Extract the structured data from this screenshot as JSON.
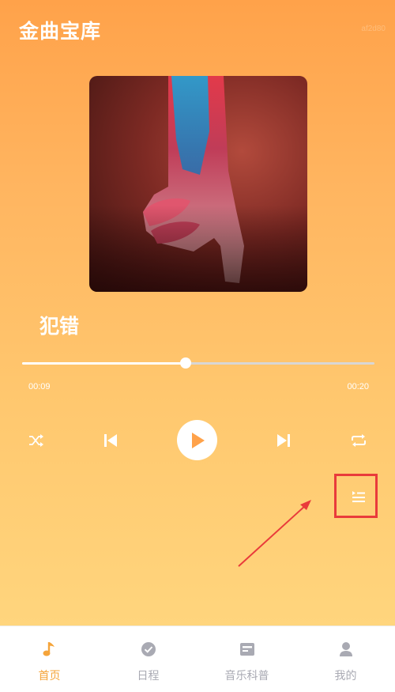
{
  "header": {
    "app_title": "金曲宝库",
    "watermark": "af2d80"
  },
  "player": {
    "song_title": "犯错",
    "current_time": "00:09",
    "total_time": "00:20",
    "progress": 0.465
  },
  "controls": [
    {
      "icon": "shuffle-icon"
    },
    {
      "icon": "previous-icon"
    },
    {
      "icon": "play-icon"
    },
    {
      "icon": "next-icon"
    },
    {
      "icon": "repeat-icon"
    },
    {
      "icon": "playlist-icon"
    }
  ],
  "tabs": [
    {
      "label": "首页",
      "icon": "music-note-icon",
      "active": true
    },
    {
      "label": "日程",
      "icon": "check-circle-icon",
      "active": false
    },
    {
      "label": "音乐科普",
      "icon": "card-icon",
      "active": false
    },
    {
      "label": "我的",
      "icon": "user-icon",
      "active": false
    }
  ],
  "colors": {
    "accent": "#f5a43a",
    "highlight": "#e93b3b",
    "tab_inactive": "#a9aab3"
  }
}
